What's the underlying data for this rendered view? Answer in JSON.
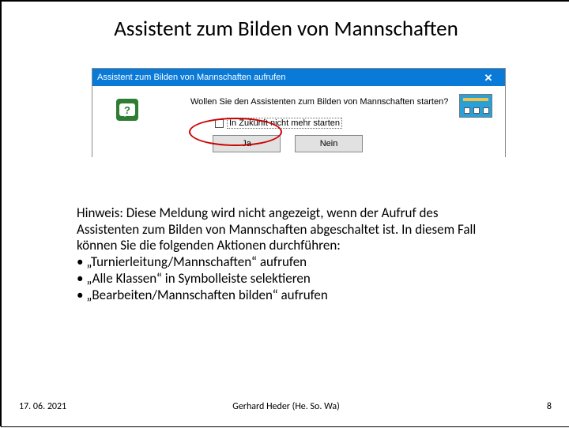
{
  "title": "Assistent zum Bilden von Mannschaften",
  "dialog": {
    "titlebar": "Assistent zum Bilden von Mannschaften aufrufen",
    "close_glyph": "✕",
    "question_glyph": "?",
    "message": "Wollen Sie den Assistenten zum Bilden von Mannschaften starten?",
    "checkbox_label": "In Zukunft nicht mehr starten",
    "yes": "Ja",
    "no": "Nein"
  },
  "note": {
    "l1": "Hinweis: Diese Meldung wird nicht angezeigt, wenn der Aufruf des",
    "l2": "Assistenten zum Bilden von Mannschaften abgeschaltet ist. In diesem Fall",
    "l3": "können Sie die folgenden Aktionen durchführen:",
    "b1": "• „Turnierleitung/Mannschaften“ aufrufen",
    "b2": "• „Alle Klassen“ in Symbolleiste selektieren",
    "b3": "• „Bearbeiten/Mannschaften bilden“ aufrufen"
  },
  "footer": {
    "date": "17. 06. 2021",
    "author": "Gerhard Heder (He. So. Wa)",
    "page": "8"
  }
}
